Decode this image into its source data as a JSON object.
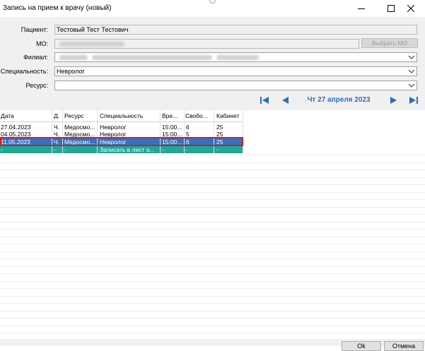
{
  "window": {
    "title": "Запись на прием к врачу (новый)"
  },
  "form": {
    "patient_label": "Пациент:",
    "patient_value": "Тестовый Тест Тестович",
    "mo_label": "МО:",
    "mo_button": "Выбрать МО",
    "branch_label": "Филиал:",
    "specialty_label": "Специальность:",
    "specialty_value": "Невролог",
    "resource_label": "Ресурс:",
    "resource_value": ""
  },
  "nav": {
    "date_label": "Чт 27 апреля 2023"
  },
  "table": {
    "columns": [
      "Дата",
      "Д.",
      "Ресурс",
      "Специальность",
      "Вре...",
      "Свобо...",
      "Кабинет"
    ],
    "rows": [
      [
        "27.04.2023",
        "Ч.",
        "Медосмо...",
        "Невролог",
        "15:00...",
        "6",
        "25"
      ],
      [
        "04.05.2023",
        "Ч.",
        "Медосмо...",
        "Невролог",
        "15:00...",
        "5",
        "25"
      ],
      [
        "11.05.2023",
        "Ч.",
        "Медосмо...",
        "Невролог",
        "15:00...",
        "6",
        "25"
      ],
      [
        "-",
        "-",
        "-",
        "Записать в лист о...",
        "-",
        "-",
        "-"
      ]
    ]
  },
  "footer": {
    "ok_label": "Ok",
    "cancel_label": "Отмена"
  },
  "colors": {
    "selected_row": "#2e73c8",
    "waitlist_row": "#1ea898",
    "highlight_border": "#e01818",
    "nav_accent": "#2a6fbd"
  }
}
